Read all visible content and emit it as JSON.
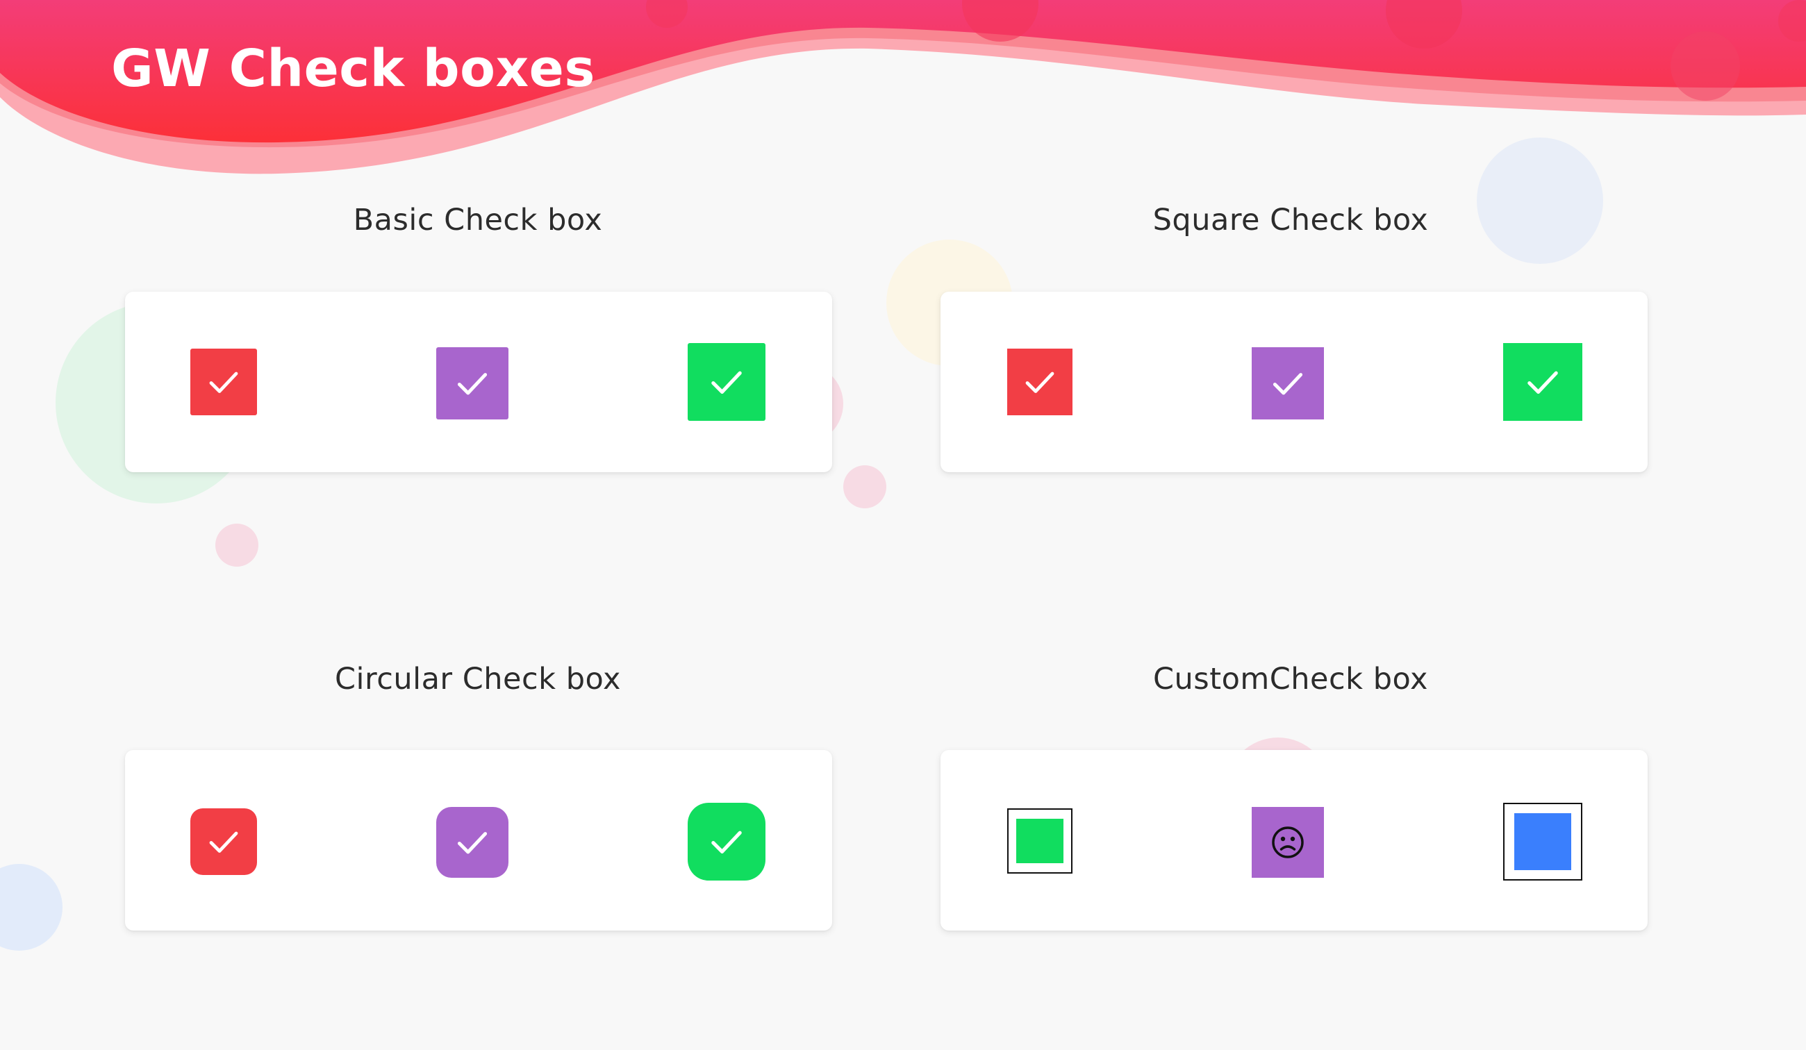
{
  "header": {
    "title": "GW Check boxes"
  },
  "colors": {
    "red": "#f23e45",
    "purple": "#a865cd",
    "green": "#11dd5f",
    "blue": "#3a7ffd",
    "header_red": "#fb3451",
    "header_pink": "#f33d78",
    "background": "#f8f8f8"
  },
  "sections": {
    "basic": {
      "title": "Basic Check box"
    },
    "square": {
      "title": "Square Check box"
    },
    "circular": {
      "title": "Circular Check box"
    },
    "custom": {
      "title": "CustomCheck box"
    }
  },
  "checkboxes": {
    "basic": [
      {
        "color": "red",
        "checked": true,
        "icon": "checkmark-icon"
      },
      {
        "color": "purple",
        "checked": true,
        "icon": "checkmark-icon"
      },
      {
        "color": "green",
        "checked": true,
        "icon": "checkmark-icon"
      }
    ],
    "square": [
      {
        "color": "red",
        "checked": true,
        "icon": "checkmark-icon"
      },
      {
        "color": "purple",
        "checked": true,
        "icon": "checkmark-icon"
      },
      {
        "color": "green",
        "checked": true,
        "icon": "checkmark-icon"
      }
    ],
    "circular": [
      {
        "color": "red",
        "checked": true,
        "icon": "checkmark-icon"
      },
      {
        "color": "purple",
        "checked": true,
        "icon": "checkmark-icon"
      },
      {
        "color": "green",
        "checked": true,
        "icon": "checkmark-icon"
      }
    ],
    "custom": [
      {
        "color": "green",
        "checked": true,
        "icon": "filled-square-icon"
      },
      {
        "color": "purple",
        "checked": true,
        "icon": "sad-face-icon"
      },
      {
        "color": "blue",
        "checked": true,
        "icon": "filled-square-icon"
      }
    ]
  }
}
